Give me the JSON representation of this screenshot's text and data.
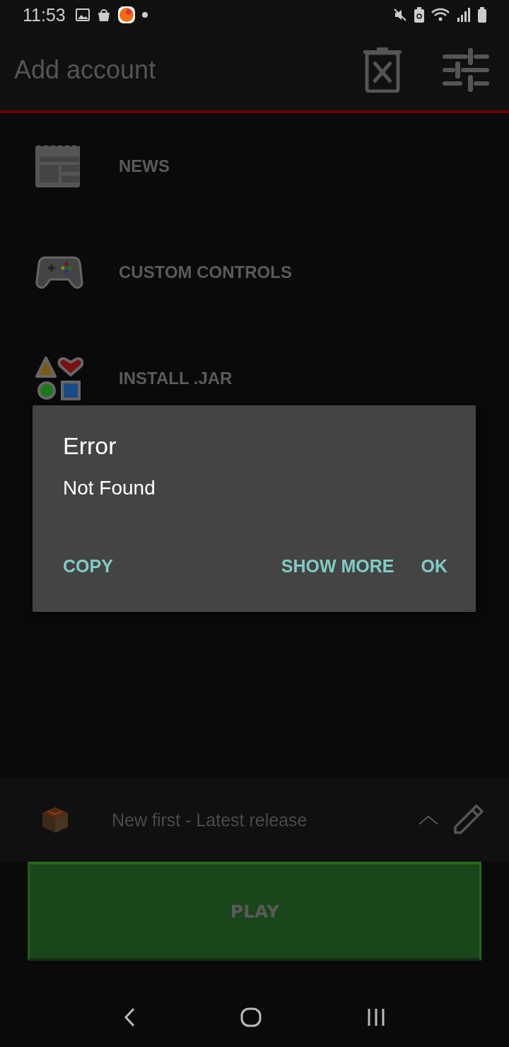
{
  "status_bar": {
    "time": "11:53"
  },
  "toolbar": {
    "title": "Add account"
  },
  "menu": [
    {
      "label": "NEWS"
    },
    {
      "label": "CUSTOM CONTROLS"
    },
    {
      "label": "INSTALL .JAR"
    }
  ],
  "dialog": {
    "title": "Error",
    "message": "Not Found",
    "buttons": [
      "COPY",
      "SHOW MORE",
      "OK"
    ]
  },
  "version_selector": {
    "label": "New first - Latest release"
  },
  "play_button": {
    "label": "PLAY"
  }
}
